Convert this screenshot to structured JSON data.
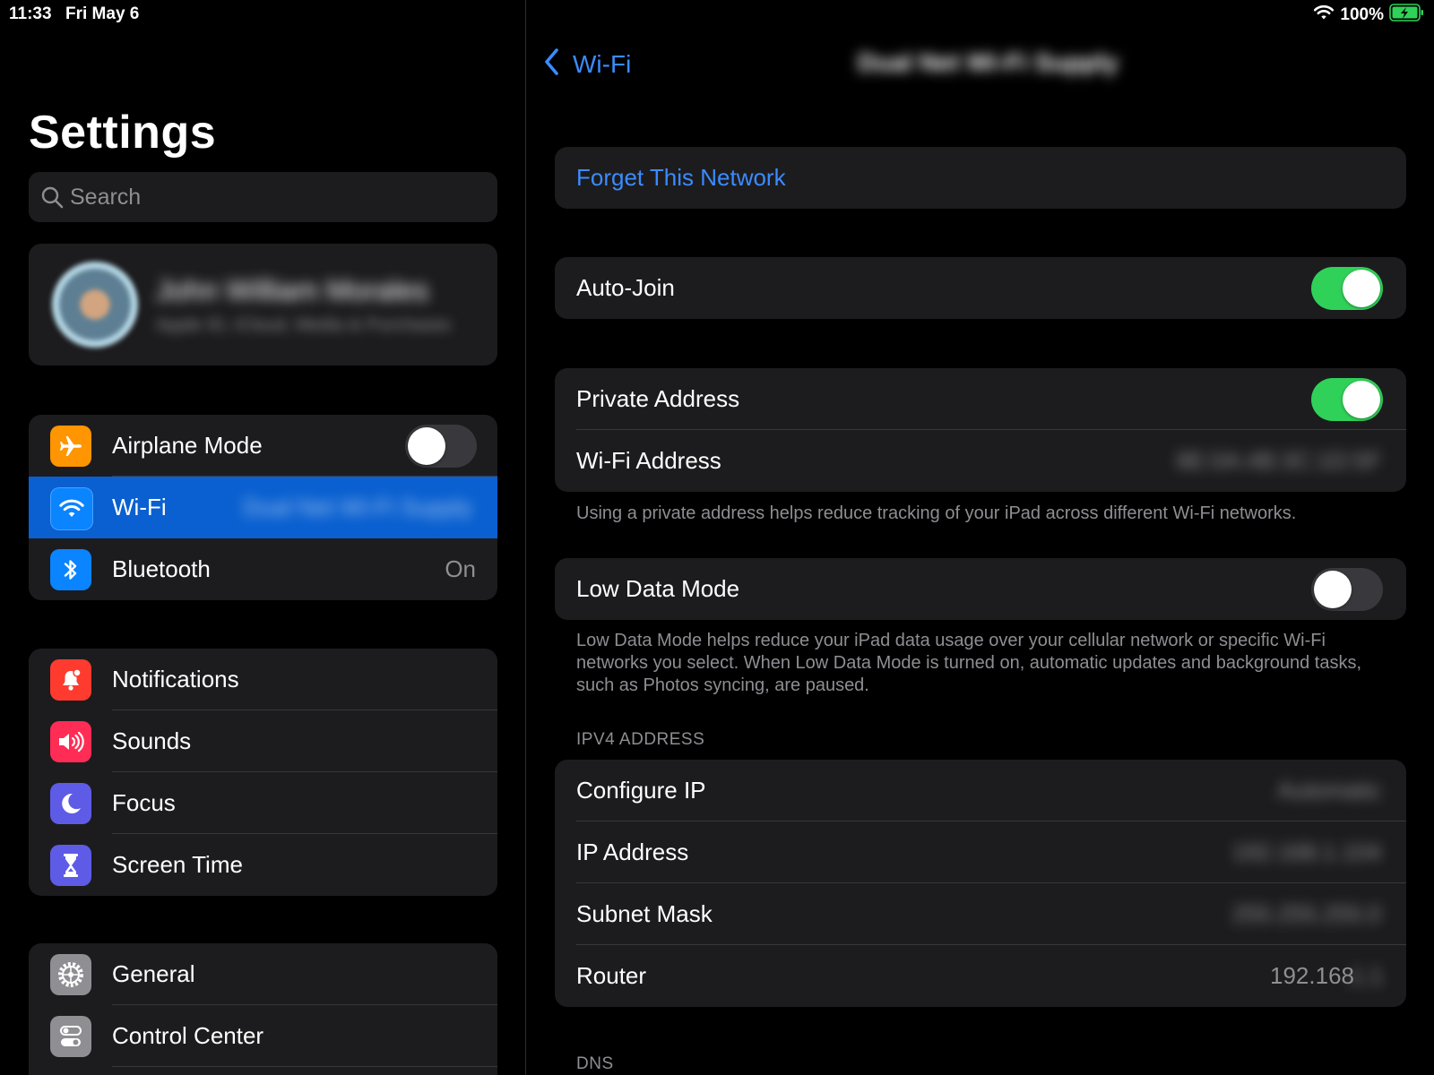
{
  "status": {
    "time": "11:33",
    "date": "Fri May 6",
    "battery": "100%"
  },
  "sidebar": {
    "title": "Settings",
    "search_placeholder": "Search",
    "profile": {
      "name": "John William Morales",
      "subtitle": "Apple ID, iCloud, Media & Purchases"
    },
    "group1": [
      {
        "label": "Airplane Mode",
        "icon": "airplane-icon",
        "color": "#ff9500",
        "toggle": false
      },
      {
        "label": "Wi-Fi",
        "icon": "wifi-icon",
        "color": "#0a84ff",
        "value": "Dual Net Wi-Fi Supply",
        "selected": true
      },
      {
        "label": "Bluetooth",
        "icon": "bluetooth-icon",
        "color": "#0a84ff",
        "value": "On"
      }
    ],
    "group2": [
      {
        "label": "Notifications",
        "icon": "bell-icon",
        "color": "#ff3b30"
      },
      {
        "label": "Sounds",
        "icon": "speaker-icon",
        "color": "#ff2d55"
      },
      {
        "label": "Focus",
        "icon": "moon-icon",
        "color": "#5e5ce6"
      },
      {
        "label": "Screen Time",
        "icon": "hourglass-icon",
        "color": "#5e5ce6"
      }
    ],
    "group3": [
      {
        "label": "General",
        "icon": "gear-icon",
        "color": "#8e8e93"
      },
      {
        "label": "Control Center",
        "icon": "switches-icon",
        "color": "#8e8e93"
      }
    ]
  },
  "detail": {
    "back_label": "Wi-Fi",
    "title": "Dual Net Wi-Fi Supply",
    "forget": "Forget This Network",
    "auto_join": {
      "label": "Auto-Join",
      "on": true
    },
    "private_address": {
      "label": "Private Address",
      "on": true
    },
    "wifi_address": {
      "label": "Wi-Fi Address",
      "value": "8E:0A:4B:3C:1D:5F"
    },
    "private_note": "Using a private address helps reduce tracking of your iPad across different Wi-Fi networks.",
    "low_data": {
      "label": "Low Data Mode",
      "on": false
    },
    "low_data_note": "Low Data Mode helps reduce your iPad data usage over your cellular network or specific Wi-Fi networks you select. When Low Data Mode is turned on, automatic updates and background tasks, such as Photos syncing, are paused.",
    "ipv4_header": "IPV4 ADDRESS",
    "configure_ip": {
      "label": "Configure IP",
      "value": "Automatic"
    },
    "ip_address": {
      "label": "IP Address",
      "value": "192.168.1.104"
    },
    "subnet_mask": {
      "label": "Subnet Mask",
      "value": "255.255.255.0"
    },
    "router": {
      "label": "Router",
      "value": "192.168",
      "value_hidden": ".1.1"
    },
    "dns_header": "DNS"
  }
}
